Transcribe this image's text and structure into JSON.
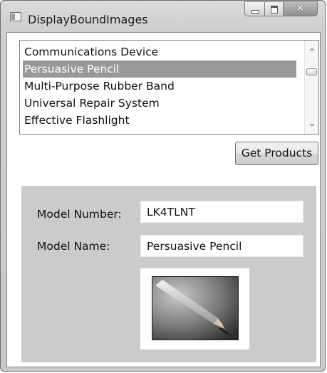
{
  "window": {
    "title": "DisplayBoundImages",
    "close_glyph": "✕",
    "icons": {
      "app": "window-icon",
      "minimize": "minimize-icon",
      "maximize": "maximize-icon",
      "close": "close-icon"
    }
  },
  "products_list": {
    "items": [
      {
        "label": "Communications Device",
        "selected": false
      },
      {
        "label": "Persuasive Pencil",
        "selected": true
      },
      {
        "label": "Multi-Purpose Rubber Band",
        "selected": false
      },
      {
        "label": "Universal Repair System",
        "selected": false
      },
      {
        "label": "Effective Flashlight",
        "selected": false
      }
    ],
    "selection_color": "#999999"
  },
  "get_products_button": {
    "label": "Get Products"
  },
  "details": {
    "panel_color": "#cbcbcb",
    "model_number_label": "Model Number:",
    "model_number_value": "LK4TLNT",
    "model_name_label": "Model Name:",
    "model_name_value": "Persuasive Pencil",
    "image_icon": "pencil-photo"
  }
}
